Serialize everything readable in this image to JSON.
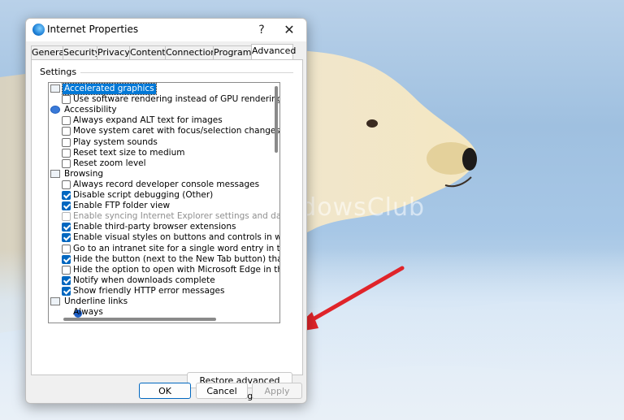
{
  "background": {
    "watermark": "TheWindowsClub"
  },
  "dialog": {
    "title": "Internet Properties",
    "help": "?",
    "close": "✕"
  },
  "tabs": [
    {
      "label": "General"
    },
    {
      "label": "Security"
    },
    {
      "label": "Privacy"
    },
    {
      "label": "Content"
    },
    {
      "label": "Connections"
    },
    {
      "label": "Programs"
    },
    {
      "label": "Advanced",
      "active": true
    }
  ],
  "settings": {
    "label": "Settings",
    "items": [
      {
        "type": "group",
        "label": "Accelerated graphics",
        "icon": "monitor-icon",
        "selected": true
      },
      {
        "type": "check",
        "label": "Use software rendering instead of GPU rendering",
        "checked": false
      },
      {
        "type": "group",
        "label": "Accessibility",
        "icon": "accessibility-icon"
      },
      {
        "type": "check",
        "label": "Always expand ALT text for images",
        "checked": false
      },
      {
        "type": "check",
        "label": "Move system caret with focus/selection changes",
        "checked": false
      },
      {
        "type": "check",
        "label": "Play system sounds",
        "checked": false
      },
      {
        "type": "check",
        "label": "Reset text size to medium",
        "checked": false
      },
      {
        "type": "check",
        "label": "Reset zoom level",
        "checked": false
      },
      {
        "type": "group",
        "label": "Browsing",
        "icon": "monitor-icon"
      },
      {
        "type": "check",
        "label": "Always record developer console messages",
        "checked": false
      },
      {
        "type": "check",
        "label": "Disable script debugging (Other)",
        "checked": true
      },
      {
        "type": "check",
        "label": "Enable FTP folder view",
        "checked": true
      },
      {
        "type": "check",
        "label": "Enable syncing Internet Explorer settings and data",
        "checked": false,
        "disabled": true
      },
      {
        "type": "check",
        "label": "Enable third-party browser extensions",
        "checked": true
      },
      {
        "type": "check",
        "label": "Enable visual styles on buttons and controls in webpages",
        "checked": true
      },
      {
        "type": "check",
        "label": "Go to an intranet site for a single word entry in the Addre",
        "checked": false
      },
      {
        "type": "check",
        "label": "Hide the button (next to the New Tab button) that opens M",
        "checked": true
      },
      {
        "type": "check",
        "label": "Hide the option to open with Microsoft Edge in the right-cl",
        "checked": false
      },
      {
        "type": "check",
        "label": "Notify when downloads complete",
        "checked": true
      },
      {
        "type": "check",
        "label": "Show friendly HTTP error messages",
        "checked": true
      },
      {
        "type": "group",
        "label": "Underline links",
        "icon": "monitor-icon"
      },
      {
        "type": "radio",
        "label": "Always",
        "checked": true
      }
    ]
  },
  "buttons": {
    "restore": "Restore advanced settings",
    "ok": "OK",
    "cancel": "Cancel",
    "apply": "Apply"
  },
  "colors": {
    "accent": "#0067c0",
    "selection": "#0078d7",
    "arrow": "#e0242a"
  }
}
